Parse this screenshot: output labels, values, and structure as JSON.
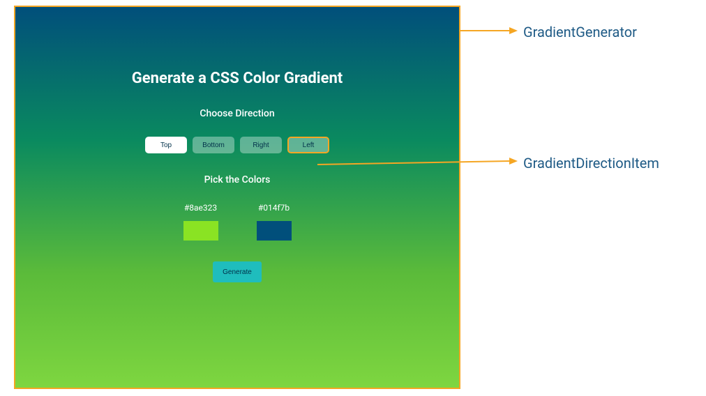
{
  "panel": {
    "title": "Generate a CSS Color Gradient",
    "direction_label": "Choose Direction",
    "directions": [
      {
        "label": "Top",
        "state": "active"
      },
      {
        "label": "Bottom",
        "state": "inactive"
      },
      {
        "label": "Right",
        "state": "inactive"
      },
      {
        "label": "Left",
        "state": "highlighted"
      }
    ],
    "colors_label": "Pick the Colors",
    "colors": [
      {
        "hex": "#8ae323",
        "value": "#8ae323"
      },
      {
        "hex": "#014f7b",
        "value": "#014f7b"
      }
    ],
    "generate_label": "Generate"
  },
  "annotations": {
    "a1": "GradientGenerator",
    "a2": "GradientDirectionItem"
  }
}
